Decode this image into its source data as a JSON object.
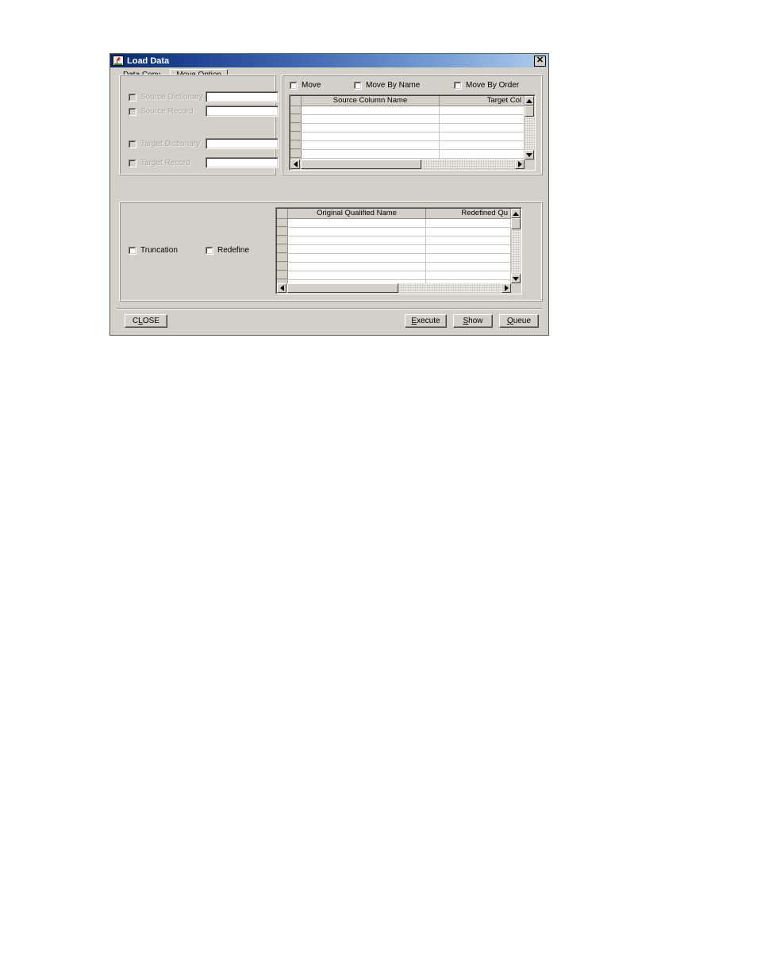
{
  "window": {
    "title": "Load Data",
    "icon": "java-coffee-cup-icon",
    "close_label": "✕",
    "titlebar_gradient_start": "#0a2a6b",
    "titlebar_gradient_end": "#b0cdec",
    "face_color": "#d4d0c8"
  },
  "tabs": [
    {
      "label": "Data Copy",
      "accel": "D",
      "active": false
    },
    {
      "label": "Move Option",
      "accel": "",
      "active": true
    }
  ],
  "left_panel": {
    "fields": [
      {
        "label": "Source Dictionary",
        "checked": false,
        "disabled": true,
        "value": "",
        "placeholder": ""
      },
      {
        "label": "Source Record",
        "checked": false,
        "disabled": true,
        "value": "",
        "placeholder": ""
      },
      {
        "label": "Target Dictionary",
        "checked": false,
        "disabled": true,
        "value": "",
        "placeholder": ""
      },
      {
        "label": "Target Record",
        "checked": false,
        "disabled": true,
        "value": "",
        "placeholder": ""
      }
    ]
  },
  "right_panel": {
    "checkboxes": [
      {
        "label": "Move",
        "checked": false
      },
      {
        "label": "Move By Name",
        "checked": false
      },
      {
        "label": "Move By Order",
        "checked": false
      }
    ],
    "grid": {
      "columns": [
        "Source Column Name",
        "Target Col"
      ],
      "rows": [],
      "empty_row_count": 7,
      "vscroll": true,
      "hscroll": true
    }
  },
  "bottom_panel": {
    "checkboxes": [
      {
        "label": "Truncation",
        "checked": false
      },
      {
        "label": "Redefine",
        "checked": false
      }
    ],
    "grid": {
      "columns": [
        "Original Qualified Name",
        "Redefined Qu"
      ],
      "rows": [],
      "empty_row_count": 8,
      "vscroll": true,
      "hscroll": true
    }
  },
  "buttons": {
    "close": {
      "label": "CLOSE",
      "accel": "L"
    },
    "execute": {
      "label": "Execute",
      "accel": "E"
    },
    "show": {
      "label": "Show",
      "accel": "S"
    },
    "queue": {
      "label": "Queue",
      "accel": "Q"
    }
  },
  "scrollbar_glyphs": {
    "up": "▲",
    "down": "▼",
    "left": "◀",
    "right": "▶"
  }
}
